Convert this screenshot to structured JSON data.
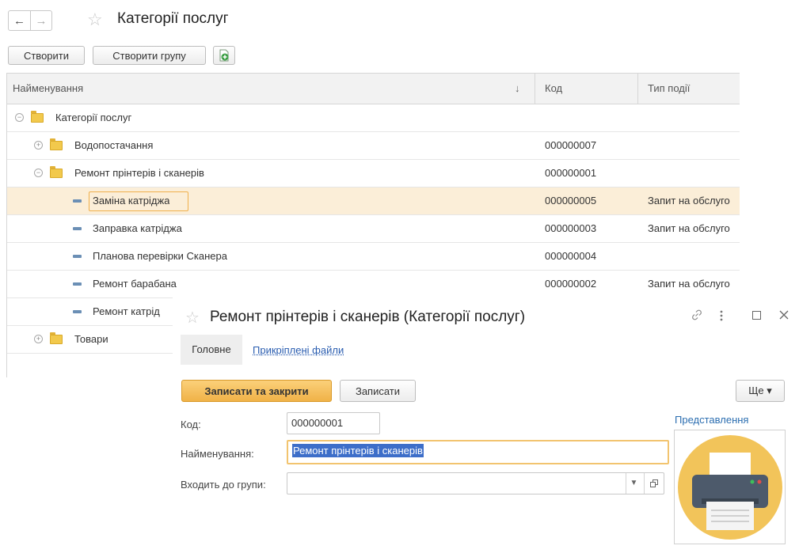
{
  "header": {
    "back_icon": "arrow-left-icon",
    "forward_icon": "arrow-right-icon",
    "favorite_icon": "star-outline-icon",
    "title": "Категорії послуг"
  },
  "toolbar": {
    "create_label": "Створити",
    "create_group_label": "Створити групу",
    "add_copy_icon": "add-document-icon"
  },
  "grid": {
    "columns": [
      {
        "label": "Найменування",
        "sort_indicator": "↓"
      },
      {
        "label": "Код"
      },
      {
        "label": "Тип події"
      }
    ],
    "rows": [
      {
        "name": "Категорії послуг",
        "code": "",
        "event_type": "",
        "kind": "group",
        "state": "expanded",
        "level": 0
      },
      {
        "name": "Водопостачання",
        "code": "000000007",
        "event_type": "",
        "kind": "group",
        "state": "collapsed",
        "level": 1
      },
      {
        "name": "Ремонт прінтерів і сканерів",
        "code": "000000001",
        "event_type": "",
        "kind": "group",
        "state": "expanded",
        "level": 1
      },
      {
        "name": "Заміна катріджа",
        "code": "000000005",
        "event_type": "Запит на обслуго",
        "kind": "item",
        "level": 2,
        "selected": true
      },
      {
        "name": "Заправка катріджа",
        "code": "000000003",
        "event_type": "Запит на обслуго",
        "kind": "item",
        "level": 2
      },
      {
        "name": "Планова перевірки Сканера",
        "code": "000000004",
        "event_type": "",
        "kind": "item",
        "level": 2
      },
      {
        "name": "Ремонт барабана",
        "code": "000000002",
        "event_type": "Запит на обслуго",
        "kind": "item",
        "level": 2
      },
      {
        "name": "Ремонт катрід",
        "code": "",
        "event_type": "",
        "kind": "item",
        "level": 2
      },
      {
        "name": "Товари",
        "code": "",
        "event_type": "",
        "kind": "group",
        "state": "collapsed",
        "level": 1
      }
    ]
  },
  "dialog": {
    "favorite_icon": "star-outline-icon",
    "title": "Ремонт прінтерів і сканерів (Категорії послуг)",
    "link_icon": "link-icon",
    "more_icon": "more-vertical-icon",
    "maximize_icon": "maximize-icon",
    "close_icon": "close-icon",
    "tabs": {
      "main": "Головне",
      "attached_files": "Прикріплені файли"
    },
    "buttons": {
      "save_close": "Записати та закрити",
      "save": "Записати",
      "more": "Ще ▾"
    },
    "fields": {
      "code_label": "Код:",
      "code_value": "000000001",
      "name_label": "Найменування:",
      "name_value": "Ремонт прінтерів і сканерів",
      "group_label": "Входить до групи:",
      "group_value": ""
    },
    "representation_label": "Представлення",
    "representation_icon": "printer-icon",
    "colors": {
      "accent": "#F0B247",
      "image_circle": "#F2C45A",
      "printer": "#4D5A6B"
    }
  }
}
